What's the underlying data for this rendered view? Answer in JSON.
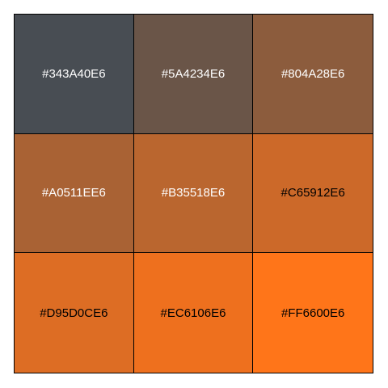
{
  "swatches": [
    {
      "label": "#343A40E6",
      "color": "#343A40",
      "text_color": "#ffffff"
    },
    {
      "label": "#5A4234E6",
      "color": "#5A4234",
      "text_color": "#ffffff"
    },
    {
      "label": "#804A28E6",
      "color": "#804A28",
      "text_color": "#ffffff"
    },
    {
      "label": "#A0511EE6",
      "color": "#A0511E",
      "text_color": "#ffffff"
    },
    {
      "label": "#B35518E6",
      "color": "#B35518",
      "text_color": "#ffffff"
    },
    {
      "label": "#C65912E6",
      "color": "#C65912",
      "text_color": "#000000"
    },
    {
      "label": "#D95D0CE6",
      "color": "#D95D0C",
      "text_color": "#000000"
    },
    {
      "label": "#EC6106E6",
      "color": "#EC6106",
      "text_color": "#000000"
    },
    {
      "label": "#FF6600E6",
      "color": "#FF6600",
      "text_color": "#000000"
    }
  ],
  "alpha": 0.9
}
